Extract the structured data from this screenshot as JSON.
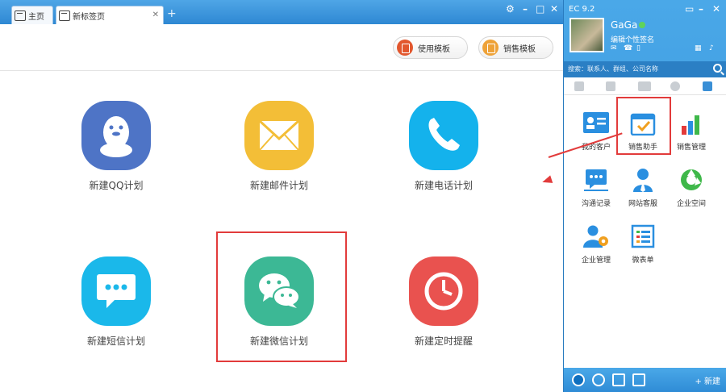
{
  "tabs": [
    {
      "label": "主页"
    },
    {
      "label": "新标签页"
    }
  ],
  "toolbar": {
    "use_template": "使用模板",
    "sales_template": "销售模板"
  },
  "plans": [
    {
      "label": "新建QQ计划",
      "icon": "qq-penguin-icon",
      "color": "#4e74c6"
    },
    {
      "label": "新建邮件计划",
      "icon": "envelope-icon",
      "color": "#f3be37"
    },
    {
      "label": "新建电话计划",
      "icon": "phone-icon",
      "color": "#14b2ec"
    },
    {
      "label": "新建短信计划",
      "icon": "sms-bubble-icon",
      "color": "#1ab8ea"
    },
    {
      "label": "新建微信计划",
      "icon": "wechat-icon",
      "color": "#3cb895"
    },
    {
      "label": "新建定时提醒",
      "icon": "clock-icon",
      "color": "#e9524f"
    }
  ],
  "ec": {
    "title": "EC 9.2",
    "username": "GaGa",
    "signature": "编辑个性签名",
    "search_placeholder": "搜索：联系人、群组、公司名称",
    "apps": [
      {
        "label": "我的客户",
        "icon": "contact-card-icon"
      },
      {
        "label": "销售助手",
        "icon": "calendar-check-icon"
      },
      {
        "label": "销售管理",
        "icon": "bar-chart-icon"
      },
      {
        "label": "沟通记录",
        "icon": "chat-log-icon"
      },
      {
        "label": "网站客服",
        "icon": "customer-service-icon"
      },
      {
        "label": "企业空间",
        "icon": "aperture-icon"
      },
      {
        "label": "企业管理",
        "icon": "user-gear-icon"
      },
      {
        "label": "微表单",
        "icon": "form-icon"
      }
    ],
    "new_button": "+ 新建"
  }
}
